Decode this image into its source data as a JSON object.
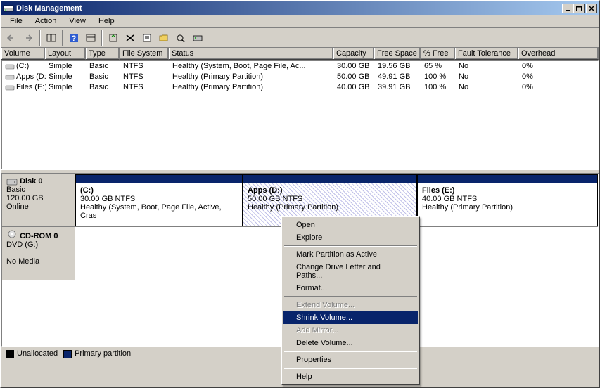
{
  "window": {
    "title": "Disk Management"
  },
  "menu": {
    "file": "File",
    "action": "Action",
    "view": "View",
    "help": "Help"
  },
  "columns": {
    "volume": "Volume",
    "layout": "Layout",
    "type": "Type",
    "fs": "File System",
    "status": "Status",
    "capacity": "Capacity",
    "free": "Free Space",
    "pct": "% Free",
    "ft": "Fault Tolerance",
    "ov": "Overhead"
  },
  "volumes": [
    {
      "name": "(C:)",
      "layout": "Simple",
      "type": "Basic",
      "fs": "NTFS",
      "status": "Healthy (System, Boot, Page File, Ac...",
      "cap": "30.00 GB",
      "free": "19.56 GB",
      "pct": "65 %",
      "ft": "No",
      "ov": "0%"
    },
    {
      "name": "Apps (D:)",
      "layout": "Simple",
      "type": "Basic",
      "fs": "NTFS",
      "status": "Healthy (Primary Partition)",
      "cap": "50.00 GB",
      "free": "49.91 GB",
      "pct": "100 %",
      "ft": "No",
      "ov": "0%"
    },
    {
      "name": "Files (E:)",
      "layout": "Simple",
      "type": "Basic",
      "fs": "NTFS",
      "status": "Healthy (Primary Partition)",
      "cap": "40.00 GB",
      "free": "39.91 GB",
      "pct": "100 %",
      "ft": "No",
      "ov": "0%"
    }
  ],
  "disk0": {
    "label": "Disk 0",
    "type": "Basic",
    "size": "120.00 GB",
    "state": "Online",
    "v0": {
      "name": "(C:)",
      "size": "30.00 GB NTFS",
      "status": "Healthy (System, Boot, Page File, Active, Cras"
    },
    "v1": {
      "name": "Apps (D:)",
      "size": "50.00 GB NTFS",
      "status": "Healthy (Primary Partition)"
    },
    "v2": {
      "name": "Files (E:)",
      "size": "40.00 GB NTFS",
      "status": "Healthy (Primary Partition)"
    }
  },
  "cdrom": {
    "label": "CD-ROM 0",
    "sub": "DVD (G:)",
    "state": "No Media"
  },
  "legend": {
    "unalloc": "Unallocated",
    "primary": "Primary partition"
  },
  "ctx": {
    "open": "Open",
    "explore": "Explore",
    "mark": "Mark Partition as Active",
    "change": "Change Drive Letter and Paths...",
    "format": "Format...",
    "extend": "Extend Volume...",
    "shrink": "Shrink Volume...",
    "mirror": "Add Mirror...",
    "delete": "Delete Volume...",
    "props": "Properties",
    "help": "Help"
  }
}
